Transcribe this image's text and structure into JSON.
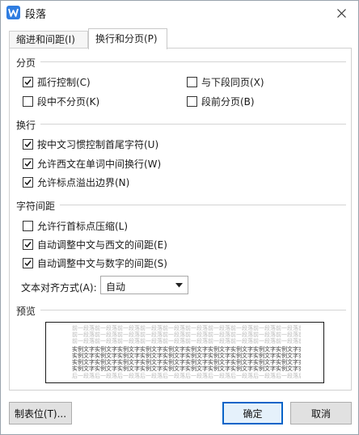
{
  "window": {
    "title": "段落"
  },
  "tabs": [
    {
      "label": "缩进和间距(I)"
    },
    {
      "label": "换行和分页(P)"
    }
  ],
  "sections": {
    "pagination": {
      "label": "分页",
      "options": [
        {
          "label": "孤行控制(C)",
          "checked": true
        },
        {
          "label": "与下段同页(X)",
          "checked": false
        },
        {
          "label": "段中不分页(K)",
          "checked": false
        },
        {
          "label": "段前分页(B)",
          "checked": false
        }
      ]
    },
    "line_break": {
      "label": "换行",
      "options": [
        {
          "label": "按中文习惯控制首尾字符(U)",
          "checked": true
        },
        {
          "label": "允许西文在单词中间换行(W)",
          "checked": true
        },
        {
          "label": "允许标点溢出边界(N)",
          "checked": true
        }
      ]
    },
    "char_spacing": {
      "label": "字符间距",
      "options": [
        {
          "label": "允许行首标点压缩(L)",
          "checked": false
        },
        {
          "label": "自动调整中文与西文的间距(E)",
          "checked": true
        },
        {
          "label": "自动调整中文与数字的间距(S)",
          "checked": true
        }
      ],
      "align_label": "文本对齐方式(A):",
      "align_value": "自动"
    },
    "preview": {
      "label": "预览",
      "lines": [
        {
          "text": "前一段落前一段落前一段落前一段落前一段落前一段落前一段落前一段落前一段落前一段落前一段落前一段落",
          "tone": "gray"
        },
        {
          "text": "前一段落前一段落前一段落前一段落前一段落前一段落前一段落前一段落前一段落前一段落前一段落前一段落",
          "tone": "gray"
        },
        {
          "text": "前一段落前一段落前一段落前一段落前一段落前一段落前一段落前一段落前一段落前一段落前一段落前一段落",
          "tone": "gray"
        },
        {
          "text": "实例文字实例文字实例文字实例文字实例文字实例文字实例文字实例文字实例文字实例文字实例文字实例文字",
          "tone": "dark"
        },
        {
          "text": "实例文字实例文字实例文字实例文字实例文字实例文字实例文字实例文字实例文字实例文字实例文字实例文字",
          "tone": "dark"
        },
        {
          "text": "实例文字实例文字实例文字实例文字实例文字实例文字实例文字实例文字实例文字实例文字实例文字实例文字",
          "tone": "dark"
        },
        {
          "text": "实例文字实例文字实例文字实例文字实例文字实例文字实例文字实例文字实例文字实例文字实例文字实例文字",
          "tone": "dark"
        },
        {
          "text": "后一段落后一段落后一段落后一段落后一段落后一段落后一段落后一段落后一段落后一段落后一段落后一段落",
          "tone": "gray"
        }
      ]
    }
  },
  "buttons": {
    "tabs": "制表位(T)...",
    "ok": "确定",
    "cancel": "取消"
  },
  "colors": {
    "accent": "#0a64c8",
    "app_icon": "#2f7de1"
  }
}
